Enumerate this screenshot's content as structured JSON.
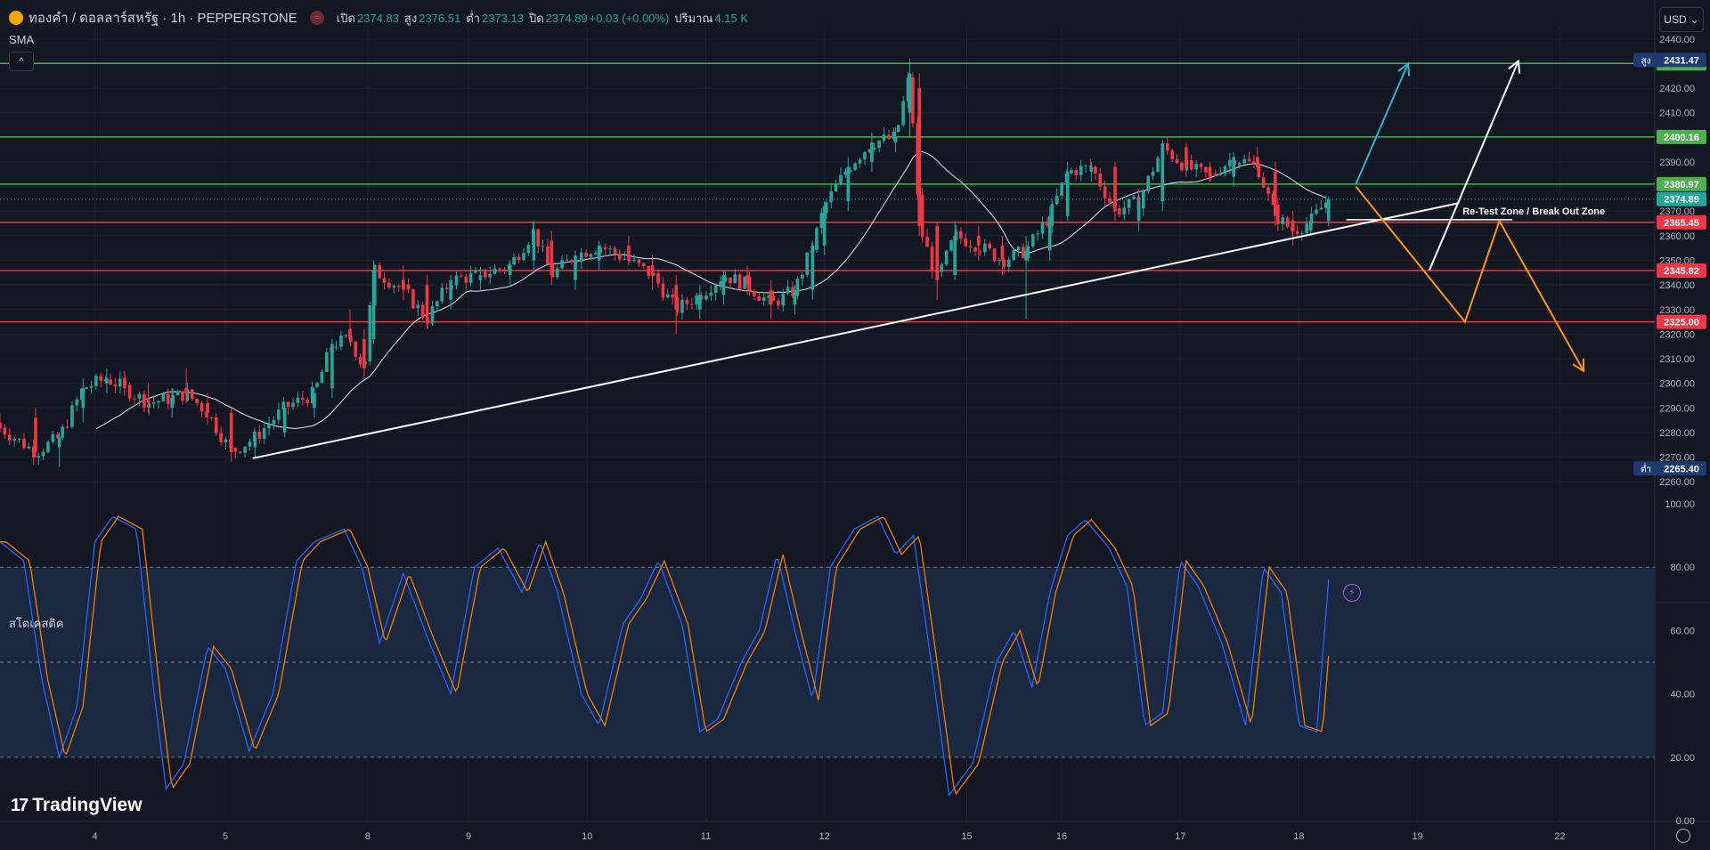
{
  "header": {
    "symbol": "ทองคำ / ดอลลาร์สหรัฐ · 1h · PEPPERSTONE",
    "badge_glyph": "≈",
    "ohlc": [
      {
        "label": "เปิด",
        "value": "2374.83"
      },
      {
        "label": "สูง",
        "value": "2376.51"
      },
      {
        "label": "ต่ำ",
        "value": "2373.13"
      },
      {
        "label": "ปิด",
        "value": "2374.89"
      }
    ],
    "change": "+0.03 (+0.00%)",
    "volume_label": "ปริมาณ",
    "volume_value": "4.15 K"
  },
  "indicator_label": "SMA",
  "collapse_glyph": "^",
  "currency": {
    "label": "USD",
    "chevron": "⌄"
  },
  "stoch_label": "สโตเคสติค",
  "brand": {
    "mark": "17",
    "name": "TradingView"
  },
  "colors": {
    "background": "#131722",
    "up": "#26a69a",
    "down": "#f23645",
    "resistance": "#4caf50",
    "support": "#f23645",
    "sma": "#e0e3eb",
    "stoch_k": "#2962ff",
    "stoch_d": "#f57c00",
    "proj_cyan": "#29b6d8",
    "proj_orange": "#ff9800"
  },
  "chart_data": [
    {
      "type": "candlestick",
      "symbol": "XAUUSD",
      "timeframe": "1h",
      "overlay": "SMA",
      "ylim": [
        2255,
        2445
      ],
      "price_ticks": [
        "2440.00",
        "2430.00",
        "2420.00",
        "2410.00",
        "2400.00",
        "2390.00",
        "2380.00",
        "2370.00",
        "2360.00",
        "2350.00",
        "2340.00",
        "2330.00",
        "2320.00",
        "2310.00",
        "2300.00",
        "2290.00",
        "2280.00",
        "2270.00",
        "2260.00"
      ],
      "x_ticks": [
        {
          "label": "4",
          "x": 3.85
        },
        {
          "label": "5",
          "x": 4.95
        },
        {
          "label": "8",
          "x": 6.15
        },
        {
          "label": "9",
          "x": 7.0
        },
        {
          "label": "10",
          "x": 8.0
        },
        {
          "label": "11",
          "x": 9.0
        },
        {
          "label": "12",
          "x": 10.0
        },
        {
          "label": "15",
          "x": 11.2
        },
        {
          "label": "16",
          "x": 12.0
        },
        {
          "label": "17",
          "x": 13.0
        },
        {
          "label": "18",
          "x": 14.0
        },
        {
          "label": "19",
          "x": 15.0
        },
        {
          "label": "22",
          "x": 16.2
        }
      ],
      "x_domain": [
        3.05,
        17.0
      ],
      "levels": [
        {
          "price": 2430.07,
          "label": "2430.07",
          "kind": "resistance"
        },
        {
          "price": 2400.16,
          "label": "2400.16",
          "kind": "resistance"
        },
        {
          "price": 2380.97,
          "label": "2380.97",
          "kind": "resistance"
        },
        {
          "price": 2365.45,
          "label": "2365.45",
          "kind": "support"
        },
        {
          "price": 2345.82,
          "label": "2345.82",
          "kind": "support"
        },
        {
          "price": 2325.0,
          "label": "2325.00",
          "kind": "support"
        }
      ],
      "high_marker": {
        "tag": "สูง",
        "price": 2431.47,
        "label": "2431.47"
      },
      "low_marker": {
        "tag": "ต่ำ",
        "price": 2265.4,
        "label": "2265.40"
      },
      "last_price": {
        "price": 2374.89,
        "label": "2374.89"
      },
      "trendline": [
        {
          "x": 5.18,
          "y": 2269.5
        },
        {
          "x": 15.35,
          "y": 2373.3
        }
      ],
      "zone_label": "Re-Test Zone / Break Out Zone",
      "zone_line": {
        "x1": 14.4,
        "x2": 15.8,
        "y": 2366.5
      },
      "projections": [
        {
          "color": "cyan",
          "points": [
            {
              "x": 14.48,
              "y": 2381
            },
            {
              "x": 14.92,
              "y": 2430
            }
          ]
        },
        {
          "color": "white",
          "points": [
            {
              "x": 15.1,
              "y": 2346
            },
            {
              "x": 15.85,
              "y": 2431
            }
          ]
        },
        {
          "color": "orange",
          "points": [
            {
              "x": 14.48,
              "y": 2380
            },
            {
              "x": 15.4,
              "y": 2325
            },
            {
              "x": 15.69,
              "y": 2366
            },
            {
              "x": 16.4,
              "y": 2305
            }
          ]
        }
      ],
      "ohlc_anchors": [
        [
          3.05,
          2284,
          2288,
          2280,
          2282
        ],
        [
          3.35,
          2286,
          2290,
          2270,
          2272
        ],
        [
          3.55,
          2274,
          2280,
          2266,
          2278
        ],
        [
          3.75,
          2290,
          2302,
          2284,
          2298
        ],
        [
          3.95,
          2300,
          2306,
          2296,
          2302
        ],
        [
          4.1,
          2302,
          2305,
          2295,
          2298
        ],
        [
          4.3,
          2294,
          2300,
          2288,
          2292
        ],
        [
          4.5,
          2290,
          2298,
          2286,
          2294
        ],
        [
          4.62,
          2298,
          2306,
          2292,
          2296
        ],
        [
          4.8,
          2292,
          2296,
          2283,
          2288
        ],
        [
          5.0,
          2288,
          2290,
          2268,
          2272
        ],
        [
          5.2,
          2274,
          2280,
          2270,
          2278
        ],
        [
          5.45,
          2280,
          2292,
          2278,
          2290
        ],
        [
          5.7,
          2290,
          2298,
          2286,
          2296
        ],
        [
          5.85,
          2298,
          2318,
          2294,
          2316
        ],
        [
          6.0,
          2322,
          2330,
          2316,
          2318
        ],
        [
          6.12,
          2318,
          2322,
          2302,
          2306
        ],
        [
          6.2,
          2318,
          2350,
          2316,
          2346
        ],
        [
          6.45,
          2342,
          2348,
          2334,
          2338
        ],
        [
          6.65,
          2340,
          2344,
          2322,
          2326
        ],
        [
          6.85,
          2334,
          2344,
          2330,
          2342
        ],
        [
          7.1,
          2342,
          2346,
          2338,
          2344
        ],
        [
          7.35,
          2344,
          2350,
          2340,
          2348
        ],
        [
          7.55,
          2350,
          2366,
          2346,
          2362
        ],
        [
          7.7,
          2358,
          2362,
          2340,
          2344
        ],
        [
          7.9,
          2342,
          2354,
          2338,
          2352
        ],
        [
          8.1,
          2350,
          2358,
          2346,
          2356
        ],
        [
          8.35,
          2356,
          2360,
          2348,
          2350
        ],
        [
          8.55,
          2348,
          2352,
          2338,
          2344
        ],
        [
          8.75,
          2340,
          2344,
          2320,
          2330
        ],
        [
          8.95,
          2330,
          2340,
          2326,
          2336
        ],
        [
          9.15,
          2336,
          2346,
          2332,
          2344
        ],
        [
          9.35,
          2344,
          2348,
          2336,
          2340
        ],
        [
          9.55,
          2338,
          2342,
          2326,
          2332
        ],
        [
          9.75,
          2332,
          2340,
          2328,
          2338
        ],
        [
          9.9,
          2338,
          2358,
          2334,
          2356
        ],
        [
          10.0,
          2356,
          2374,
          2352,
          2372
        ],
        [
          10.2,
          2374,
          2392,
          2370,
          2388
        ],
        [
          10.4,
          2390,
          2402,
          2386,
          2398
        ],
        [
          10.6,
          2398,
          2404,
          2394,
          2400
        ],
        [
          10.72,
          2410,
          2432,
          2400,
          2426
        ],
        [
          10.8,
          2420,
          2426,
          2360,
          2364
        ],
        [
          10.95,
          2364,
          2366,
          2334,
          2342
        ],
        [
          11.1,
          2344,
          2366,
          2342,
          2360
        ],
        [
          11.3,
          2360,
          2364,
          2350,
          2356
        ],
        [
          11.5,
          2356,
          2360,
          2344,
          2350
        ],
        [
          11.7,
          2350,
          2360,
          2326,
          2354
        ],
        [
          11.9,
          2354,
          2372,
          2350,
          2368
        ],
        [
          12.05,
          2368,
          2390,
          2366,
          2386
        ],
        [
          12.25,
          2386,
          2390,
          2382,
          2388
        ],
        [
          12.45,
          2388,
          2390,
          2366,
          2370
        ],
        [
          12.65,
          2366,
          2378,
          2362,
          2374
        ],
        [
          12.85,
          2374,
          2398,
          2370,
          2396
        ],
        [
          13.05,
          2396,
          2398,
          2384,
          2388
        ],
        [
          13.25,
          2388,
          2390,
          2382,
          2384
        ],
        [
          13.45,
          2384,
          2394,
          2380,
          2392
        ],
        [
          13.65,
          2392,
          2396,
          2386,
          2388
        ],
        [
          13.8,
          2386,
          2390,
          2364,
          2368
        ],
        [
          13.95,
          2366,
          2370,
          2356,
          2362
        ],
        [
          14.1,
          2362,
          2368,
          2360,
          2366
        ],
        [
          14.25,
          2366,
          2376,
          2364,
          2375
        ]
      ]
    },
    {
      "type": "line",
      "title": "สโตเคสติค",
      "ylim": [
        0,
        100
      ],
      "ticks": [
        "100.00",
        "80.00",
        "60.00",
        "40.00",
        "20.00",
        "0.00"
      ],
      "band": [
        20,
        80
      ],
      "midline": 50,
      "series_k_anchors": [
        [
          3.05,
          88
        ],
        [
          3.25,
          82
        ],
        [
          3.4,
          45
        ],
        [
          3.55,
          20
        ],
        [
          3.7,
          36
        ],
        [
          3.85,
          88
        ],
        [
          4.0,
          96
        ],
        [
          4.2,
          92
        ],
        [
          4.35,
          40
        ],
        [
          4.45,
          10
        ],
        [
          4.6,
          18
        ],
        [
          4.8,
          55
        ],
        [
          4.95,
          48
        ],
        [
          5.15,
          22
        ],
        [
          5.35,
          40
        ],
        [
          5.55,
          82
        ],
        [
          5.7,
          88
        ],
        [
          5.95,
          92
        ],
        [
          6.1,
          80
        ],
        [
          6.25,
          56
        ],
        [
          6.45,
          78
        ],
        [
          6.65,
          58
        ],
        [
          6.85,
          40
        ],
        [
          7.05,
          80
        ],
        [
          7.25,
          86
        ],
        [
          7.45,
          72
        ],
        [
          7.6,
          88
        ],
        [
          7.75,
          72
        ],
        [
          7.95,
          40
        ],
        [
          8.1,
          30
        ],
        [
          8.3,
          62
        ],
        [
          8.45,
          70
        ],
        [
          8.6,
          82
        ],
        [
          8.8,
          62
        ],
        [
          8.95,
          28
        ],
        [
          9.1,
          32
        ],
        [
          9.3,
          50
        ],
        [
          9.45,
          60
        ],
        [
          9.6,
          84
        ],
        [
          9.75,
          60
        ],
        [
          9.9,
          38
        ],
        [
          10.05,
          80
        ],
        [
          10.25,
          92
        ],
        [
          10.45,
          96
        ],
        [
          10.6,
          84
        ],
        [
          10.75,
          90
        ],
        [
          10.9,
          50
        ],
        [
          11.05,
          8
        ],
        [
          11.25,
          18
        ],
        [
          11.45,
          50
        ],
        [
          11.6,
          60
        ],
        [
          11.75,
          42
        ],
        [
          11.9,
          72
        ],
        [
          12.05,
          90
        ],
        [
          12.2,
          95
        ],
        [
          12.4,
          86
        ],
        [
          12.55,
          74
        ],
        [
          12.7,
          30
        ],
        [
          12.85,
          34
        ],
        [
          13.0,
          82
        ],
        [
          13.15,
          74
        ],
        [
          13.35,
          56
        ],
        [
          13.55,
          30
        ],
        [
          13.7,
          80
        ],
        [
          13.85,
          72
        ],
        [
          14.0,
          30
        ],
        [
          14.15,
          28
        ],
        [
          14.25,
          76
        ]
      ],
      "d_lag": 0.05
    }
  ]
}
